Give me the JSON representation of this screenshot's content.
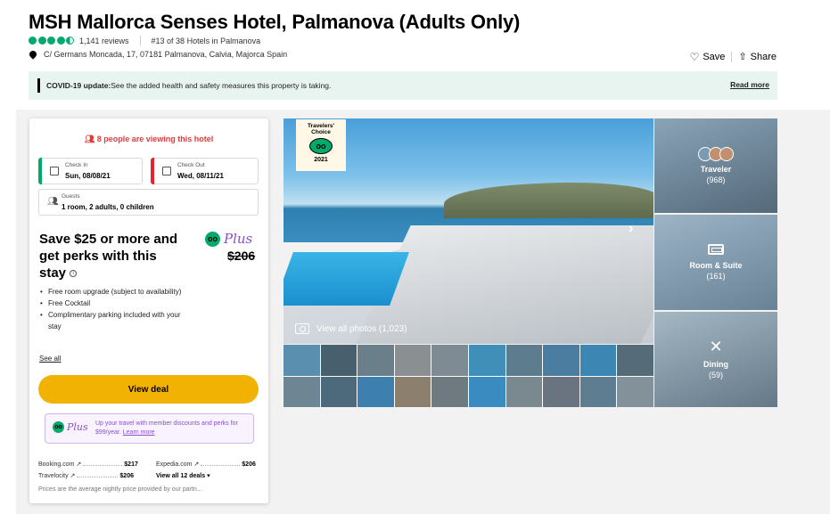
{
  "header": {
    "title": "MSH Mallorca Senses Hotel, Palmanova (Adults Only)",
    "rating_bubbles": 4.5,
    "reviews": "1,141 reviews",
    "rank": "#13 of 38 Hotels in Palmanova",
    "address": "C/ Germans Moncada, 17, 07181 Palmanova, Calvia, Majorca Spain",
    "save_label": "Save",
    "share_label": "Share"
  },
  "covid": {
    "label": "COVID-19 update:",
    "text": " See the added health and safety measures this property is taking.",
    "read_more": "Read more"
  },
  "booking": {
    "viewing": "8 people are viewing this hotel",
    "checkin_label": "Check In",
    "checkin_value": "Sun, 08/08/21",
    "checkout_label": "Check Out",
    "checkout_value": "Wed, 08/11/21",
    "guests_label": "Guests",
    "guests_value": "1 room, 2 adults, 0 children",
    "save_headline": "Save $25 or more and get perks with this stay",
    "plus_label": "Plus",
    "strike_price": "$206",
    "perks": [
      "Free room upgrade (subject to availability)",
      "Free Cocktail",
      "Complimentary parking included with your stay"
    ],
    "see_all": "See all",
    "view_deal": "View deal",
    "promo_text": "Up your travel with member discounts and perks for $99/year.",
    "promo_link": "Learn more",
    "offers": [
      {
        "site": "Booking.com ↗",
        "price": "$217"
      },
      {
        "site": "Expedia.com ↗",
        "price": "$206"
      },
      {
        "site": "Travelocity ↗",
        "price": "$206"
      }
    ],
    "all_deals": "View all 12 deals ▾",
    "footnote": "Prices are the average nightly price provided by our partn..."
  },
  "gallery": {
    "badge_line1": "Travelers'",
    "badge_line2": "Choice",
    "badge_year": "2021",
    "view_all": "View all photos (1,023)",
    "categories": [
      {
        "label": "Traveler",
        "count": "(968)"
      },
      {
        "label": "Room & Suite",
        "count": "(161)"
      },
      {
        "label": "Dining",
        "count": "(59)"
      }
    ]
  },
  "colors": {
    "bubble_green": "#00aa6c",
    "alert_red": "#e33b3b",
    "deal_yellow": "#f2b203",
    "plus_purple": "#8a4fd0",
    "covid_bg": "#e8f4ef"
  }
}
